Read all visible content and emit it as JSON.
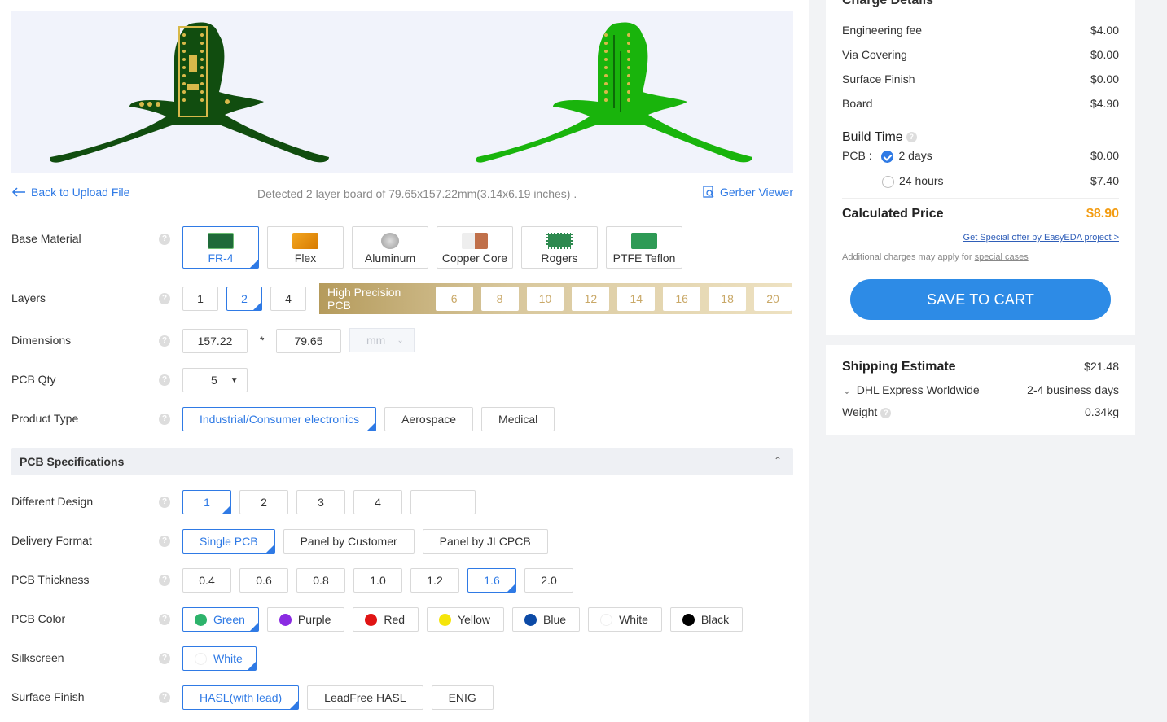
{
  "preview": {
    "top_color": "#114d0f",
    "bottom_color": "#19b40c"
  },
  "link_row": {
    "back_label": "Back to Upload File",
    "detected_text": "Detected 2 layer board of 79.65x157.22mm(3.14x6.19 inches) .",
    "gerber_label": "Gerber Viewer"
  },
  "base_material": {
    "label": "Base Material",
    "options": [
      "FR-4",
      "Flex",
      "Aluminum",
      "Copper Core",
      "Rogers",
      "PTFE Teflon"
    ],
    "selected": "FR-4"
  },
  "layers": {
    "label": "Layers",
    "options": [
      "1",
      "2",
      "4"
    ],
    "selected": "2",
    "high_precision_label": "High Precision PCB",
    "high_precision_options": [
      "6",
      "8",
      "10",
      "12",
      "14",
      "16",
      "18",
      "20"
    ]
  },
  "dimensions": {
    "label": "Dimensions",
    "width": "157.22",
    "separator": "*",
    "height": "79.65",
    "unit": "mm"
  },
  "pcb_qty": {
    "label": "PCB Qty",
    "value": "5"
  },
  "product_type": {
    "label": "Product Type",
    "options": [
      "Industrial/Consumer electronics",
      "Aerospace",
      "Medical"
    ],
    "selected": "Industrial/Consumer electronics"
  },
  "section": {
    "title": "PCB Specifications"
  },
  "different_design": {
    "label": "Different Design",
    "options": [
      "1",
      "2",
      "3",
      "4",
      ""
    ],
    "selected": "1"
  },
  "delivery_format": {
    "label": "Delivery Format",
    "options": [
      "Single PCB",
      "Panel by Customer",
      "Panel by JLCPCB"
    ],
    "selected": "Single PCB"
  },
  "pcb_thickness": {
    "label": "PCB Thickness",
    "options": [
      "0.4",
      "0.6",
      "0.8",
      "1.0",
      "1.2",
      "1.6",
      "2.0"
    ],
    "selected": "1.6"
  },
  "pcb_color": {
    "label": "PCB Color",
    "options": [
      {
        "name": "Green",
        "color": "#2db36b"
      },
      {
        "name": "Purple",
        "color": "#8a2be2"
      },
      {
        "name": "Red",
        "color": "#e01414"
      },
      {
        "name": "Yellow",
        "color": "#f5e50a"
      },
      {
        "name": "Blue",
        "color": "#0c4aa6"
      },
      {
        "name": "White",
        "color": "#ffffff"
      },
      {
        "name": "Black",
        "color": "#000000"
      }
    ],
    "selected": "Green"
  },
  "silkscreen": {
    "label": "Silkscreen",
    "options": [
      {
        "name": "White",
        "color": "#ffffff"
      }
    ],
    "selected": "White"
  },
  "surface_finish": {
    "label": "Surface Finish",
    "options": [
      "HASL(with lead)",
      "LeadFree HASL",
      "ENIG"
    ],
    "selected": "HASL(with lead)"
  },
  "charges": {
    "title": "Charge Details",
    "items": [
      {
        "label": "Engineering fee",
        "value": "$4.00"
      },
      {
        "label": "Via Covering",
        "value": "$0.00"
      },
      {
        "label": "Surface Finish",
        "value": "$0.00"
      },
      {
        "label": "Board",
        "value": "$4.90"
      }
    ],
    "build_time_title": "Build Time",
    "pcb_label": "PCB",
    "build_options": [
      {
        "label": "2 days",
        "value": "$0.00",
        "selected": true
      },
      {
        "label": "24 hours",
        "value": "$7.40",
        "selected": false
      }
    ],
    "calculated_label": "Calculated Price",
    "calculated_value": "$8.90",
    "special_offer": "Get Special offer by EasyEDA project >",
    "additional_text": "Additional charges may apply for",
    "special_cases": "special cases",
    "save_label": "SAVE TO CART"
  },
  "shipping": {
    "title": "Shipping Estimate",
    "price": "$21.48",
    "method": "DHL Express Worldwide",
    "days": "2-4 business days",
    "weight_label": "Weight",
    "weight_value": "0.34kg"
  },
  "colors": {
    "accent": "#2f7ae5",
    "price": "#f39c12",
    "save_button": "#2d8be6"
  }
}
